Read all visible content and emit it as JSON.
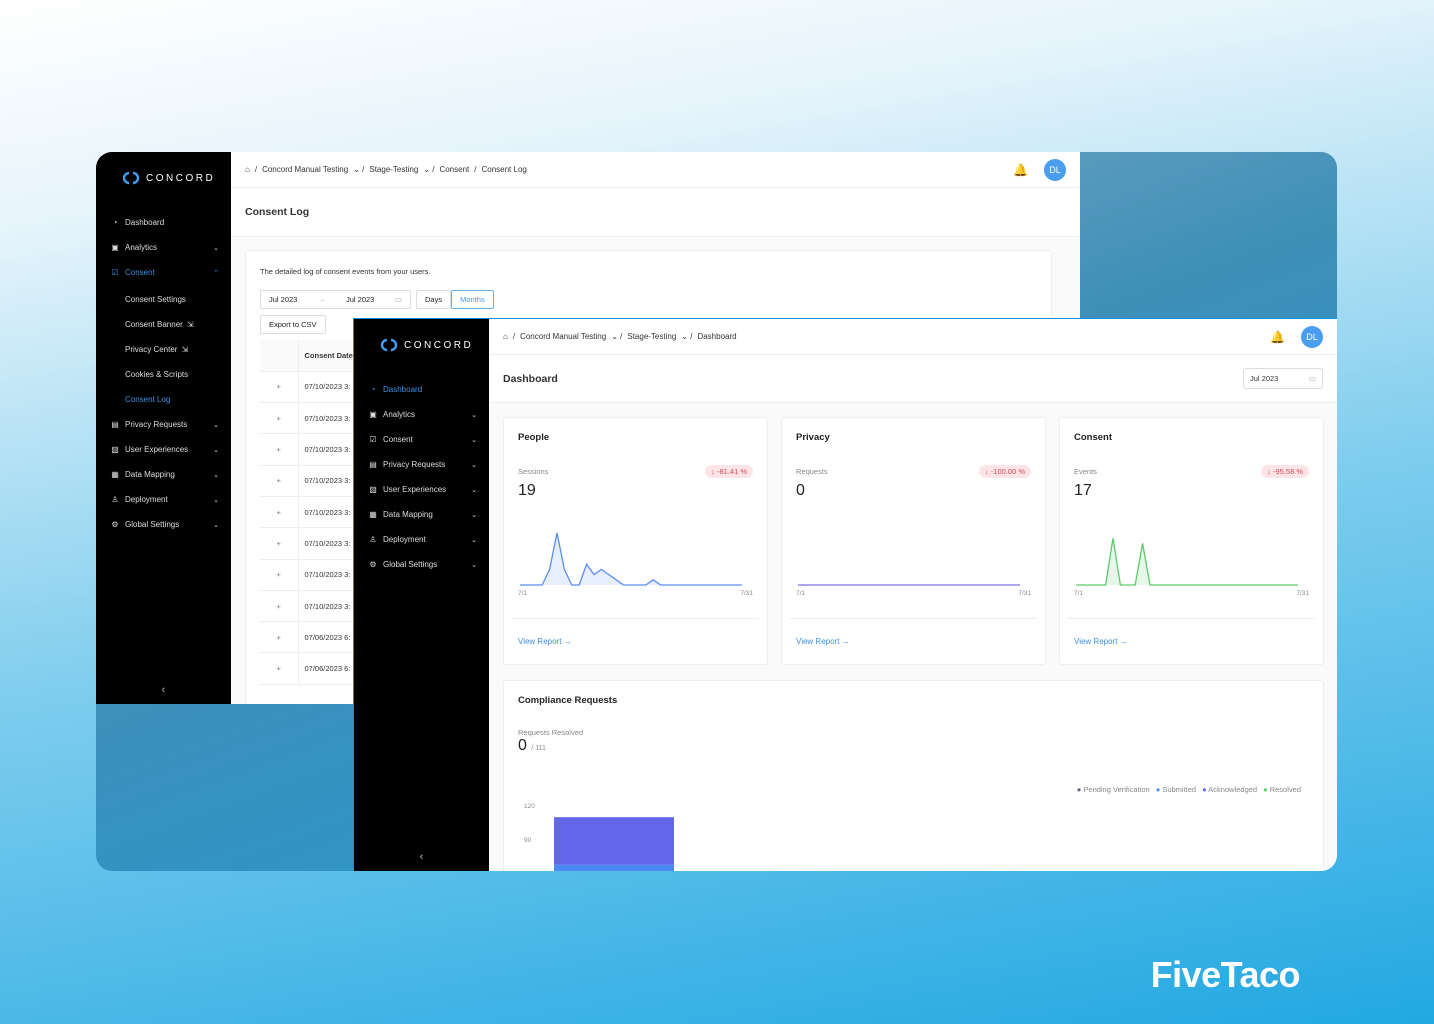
{
  "brand": "FiveTaco",
  "logo": "CONCORD",
  "back": {
    "breadcrumb": [
      "Concord Manual Testing",
      "Stage-Testing",
      "Consent",
      "Consent Log"
    ],
    "avatar": "DL",
    "title": "Consent Log",
    "description": "The detailed log of consent events from your users.",
    "range_start": "Jul 2023",
    "range_end": "Jul 2023",
    "toggle": [
      "Days",
      "Months"
    ],
    "toggle_selected": "Months",
    "export": "Export to CSV",
    "column": "Consent Date",
    "rows": [
      "07/10/2023 3:",
      "07/10/2023 3:",
      "07/10/2023 3:",
      "07/10/2023 3:",
      "07/10/2023 3:",
      "07/10/2023 3:",
      "07/10/2023 3:",
      "07/10/2023 3:",
      "07/06/2023 6:",
      "07/06/2023 6:"
    ],
    "nav": [
      {
        "label": "Dashboard",
        "icon": "dashboard-icon"
      },
      {
        "label": "Analytics",
        "icon": "analytics-icon",
        "chev": "⌄"
      },
      {
        "label": "Consent",
        "icon": "consent-icon",
        "chev": "⌃",
        "active": true,
        "children": [
          {
            "label": "Consent Settings"
          },
          {
            "label": "Consent Banner",
            "ext": true
          },
          {
            "label": "Privacy Center",
            "ext": true
          },
          {
            "label": "Cookies & Scripts"
          },
          {
            "label": "Consent Log",
            "active": true
          }
        ]
      },
      {
        "label": "Privacy Requests",
        "icon": "privacy-requests-icon",
        "chev": "⌄"
      },
      {
        "label": "User Experiences",
        "icon": "user-experiences-icon",
        "chev": "⌄"
      },
      {
        "label": "Data Mapping",
        "icon": "data-mapping-icon",
        "chev": "⌄"
      },
      {
        "label": "Deployment",
        "icon": "deployment-icon",
        "chev": "⌄"
      },
      {
        "label": "Global Settings",
        "icon": "settings-icon",
        "chev": "⌄"
      }
    ]
  },
  "front": {
    "breadcrumb": [
      "Concord Manual Testing",
      "Stage-Testing",
      "Dashboard"
    ],
    "avatar": "DL",
    "title": "Dashboard",
    "date": "Jul 2023",
    "nav": [
      {
        "label": "Dashboard",
        "icon": "dashboard-icon",
        "active": true
      },
      {
        "label": "Analytics",
        "icon": "analytics-icon",
        "chev": "⌄"
      },
      {
        "label": "Consent",
        "icon": "consent-icon",
        "chev": "⌄"
      },
      {
        "label": "Privacy Requests",
        "icon": "privacy-requests-icon",
        "chev": "⌄"
      },
      {
        "label": "User Experiences",
        "icon": "user-experiences-icon",
        "chev": "⌄"
      },
      {
        "label": "Data Mapping",
        "icon": "data-mapping-icon",
        "chev": "⌄"
      },
      {
        "label": "Deployment",
        "icon": "deployment-icon",
        "chev": "⌄"
      },
      {
        "label": "Global Settings",
        "icon": "settings-icon",
        "chev": "⌄"
      }
    ],
    "kpis": [
      {
        "title": "People",
        "label": "Sessions",
        "value": "19",
        "change": "-81.41 %",
        "color": "#5b8def",
        "x_start": "7/1",
        "x_end": "7/31",
        "link": "View Report"
      },
      {
        "title": "Privacy",
        "label": "Requests",
        "value": "0",
        "change": "-100.00 %",
        "color": "#7b72e6",
        "x_start": "7/1",
        "x_end": "7/31",
        "link": "View Report"
      },
      {
        "title": "Consent",
        "label": "Events",
        "value": "17",
        "change": "-95.58 %",
        "color": "#5cc96a",
        "x_start": "7/1",
        "x_end": "7/31",
        "link": "View Report"
      }
    ],
    "compliance": {
      "title": "Compliance Requests",
      "label": "Requests Resolved",
      "resolved": "0",
      "total": "/ 111",
      "legend": [
        {
          "name": "Pending Verification",
          "color": "#5f6478"
        },
        {
          "name": "Submitted",
          "color": "#4a8af0"
        },
        {
          "name": "Acknowledged",
          "color": "#6366e8"
        },
        {
          "name": "Resolved",
          "color": "#5cc96a"
        }
      ],
      "yticks": [
        "120",
        "90"
      ]
    }
  },
  "chart_data": [
    {
      "type": "area",
      "title": "People",
      "x_start": "7/1",
      "x_end": "7/31",
      "values": [
        0,
        0,
        0,
        0,
        3,
        10,
        3,
        0,
        0,
        4,
        2,
        3,
        2,
        1,
        0,
        0,
        0,
        0,
        1,
        0,
        0,
        0,
        0,
        0,
        0,
        0,
        0,
        0,
        0,
        0,
        0
      ]
    },
    {
      "type": "line",
      "title": "Privacy",
      "x_start": "7/1",
      "x_end": "7/31",
      "values": [
        0,
        0,
        0,
        0,
        0,
        0,
        0,
        0,
        0,
        0,
        0,
        0,
        0,
        0,
        0,
        0,
        0,
        0,
        0,
        0,
        0,
        0,
        0,
        0,
        0,
        0,
        0,
        0,
        0,
        0,
        0
      ]
    },
    {
      "type": "area",
      "title": "Consent",
      "x_start": "7/1",
      "x_end": "7/31",
      "values": [
        0,
        0,
        0,
        0,
        0,
        9,
        0,
        0,
        0,
        8,
        0,
        0,
        0,
        0,
        0,
        0,
        0,
        0,
        0,
        0,
        0,
        0,
        0,
        0,
        0,
        0,
        0,
        0,
        0,
        0,
        0
      ]
    },
    {
      "type": "bar",
      "title": "Compliance Requests",
      "stacked": true,
      "ylim": [
        0,
        120
      ],
      "yticks": [
        90,
        120
      ],
      "series": [
        {
          "name": "Submitted",
          "values": [
            69
          ]
        },
        {
          "name": "Acknowledged",
          "values": [
            42
          ]
        }
      ]
    }
  ]
}
